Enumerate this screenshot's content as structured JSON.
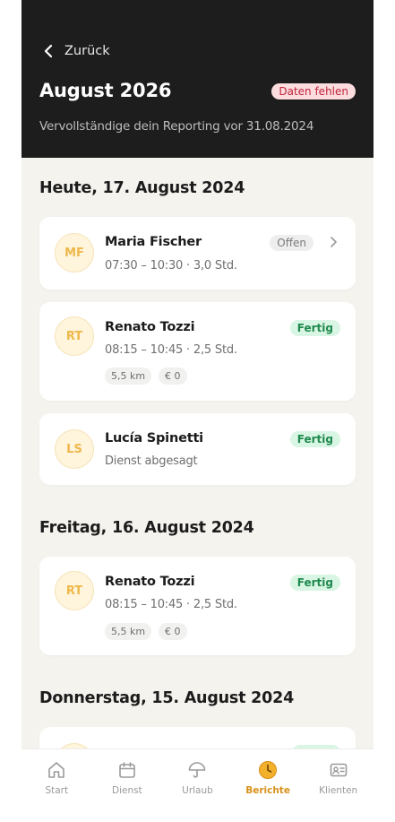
{
  "header": {
    "back_label": "Zurück",
    "title": "August 2026",
    "missing_badge": "Daten fehlen",
    "subline": "Vervollständige dein Reporting vor  31.08.2024"
  },
  "days": [
    {
      "title": "Heute, 17. August 2024",
      "entries": [
        {
          "initials": "MF",
          "name": "Maria Fischer",
          "meta": "07:30 – 10:30 · 3,0 Std.",
          "status": "Offen"
        },
        {
          "initials": "RT",
          "name": "Renato Tozzi",
          "meta": "08:15 – 10:45 · 2,5 Std.",
          "status": "Fertig",
          "chips": [
            "5,5 km",
            "€ 0"
          ]
        },
        {
          "initials": "LS",
          "name": "Lucía Spinetti",
          "meta": "Dienst abgesagt",
          "status": "Fertig"
        }
      ]
    },
    {
      "title": "Freitag, 16. August 2024",
      "entries": [
        {
          "initials": "RT",
          "name": "Renato Tozzi",
          "meta": "08:15 – 10:45 · 2,5 Std.",
          "status": "Fertig",
          "chips": [
            "5,5 km",
            "€ 0"
          ]
        }
      ]
    },
    {
      "title": "Donnerstag, 15. August 2024",
      "entries": []
    }
  ],
  "tabbar": {
    "items": [
      {
        "label": "Start",
        "icon": "home-icon"
      },
      {
        "label": "Dienst",
        "icon": "calendar-icon"
      },
      {
        "label": "Urlaub",
        "icon": "umbrella-icon"
      },
      {
        "label": "Berichte",
        "icon": "clock-icon",
        "active": true
      },
      {
        "label": "Klienten",
        "icon": "contact-card-icon"
      }
    ]
  },
  "colors": {
    "header_bg": "#1d1d1d",
    "page_bg": "#f5f3ee",
    "accent": "#d8901a",
    "done_green": "#1f8a4e",
    "missing_red": "#c2243a"
  }
}
